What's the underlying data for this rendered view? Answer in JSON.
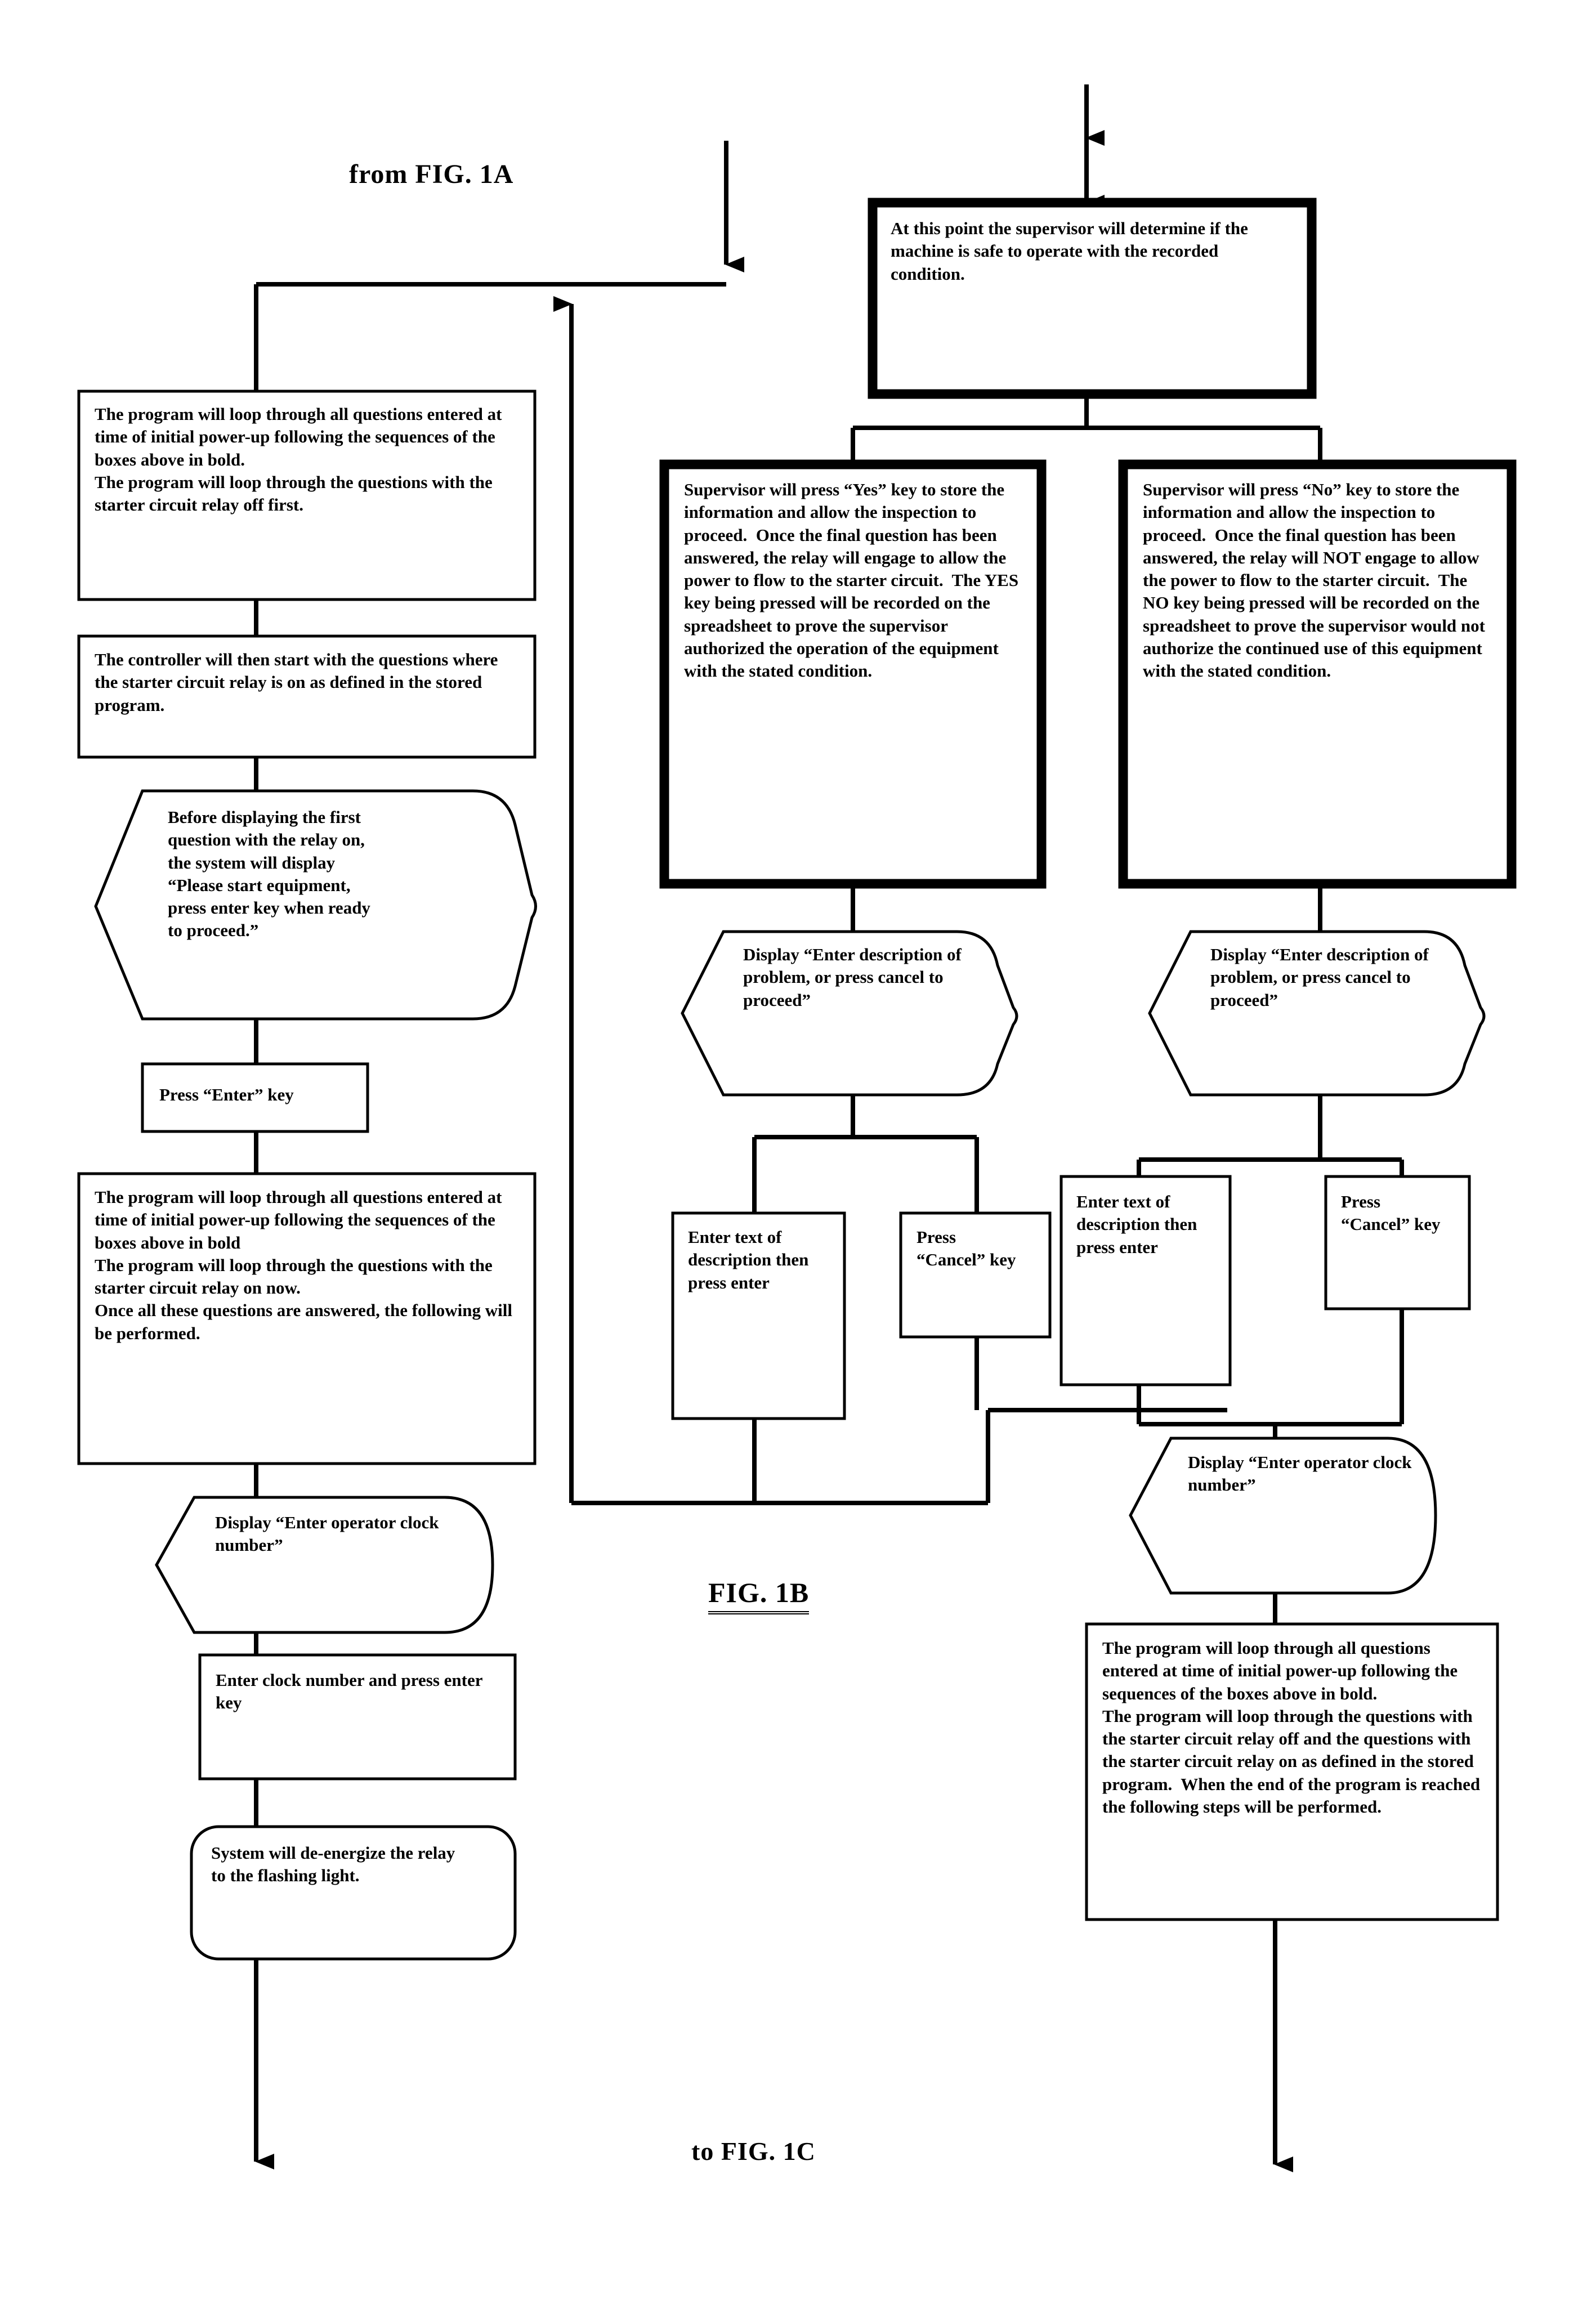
{
  "figure": {
    "from_label": "from FIG.  1A",
    "figure_label": "FIG.  1B",
    "to_label": "to FIG.  1C"
  },
  "nodes": {
    "left_loop_1": "The program will loop through all questions entered at time of initial power-up following the sequences of the boxes above in bold.\nThe program will loop through the questions with the starter circuit relay off first.",
    "controller_start": "The controller will then start with the questions where the starter circuit relay is on as defined in the stored program.",
    "before_display": "Before displaying the first question with the relay on, the system will display “Please start equipment, press enter key when ready to proceed.”",
    "press_enter": "Press “Enter” key",
    "left_loop_2": "The program will loop through all questions entered at time of initial power-up following the sequences of the boxes above in bold\nThe program will loop through the questions with the starter circuit relay on now.\nOnce all these questions are answered, the following will be performed.",
    "display_clock_left": "Display “Enter operator clock number”",
    "enter_clock_left": "Enter clock number and press enter key",
    "deenergize": "System will de-energize the relay to the flashing light.",
    "supervisor_determine": "At this point the supervisor will determine if the machine is safe to operate with the recorded condition.",
    "supervisor_yes": "Supervisor will press “Yes” key to store the information and allow the inspection to proceed.  Once the final question has been answered, the relay will engage to allow the power to flow to the starter circuit.  The YES key being pressed will be recorded on the spreadsheet to prove the supervisor authorized the operation of the equipment with the stated condition.",
    "supervisor_no": "Supervisor will press “No” key to store the information and allow the inspection to proceed.  Once the final question has been answered, the relay will NOT engage to allow the power to flow to the starter circuit.  The NO key being pressed will be recorded on the spreadsheet to prove the supervisor would not authorize the continued use of this equipment with the stated condition.",
    "display_desc_yes": "Display “Enter description of problem, or press cancel to proceed”",
    "display_desc_no": "Display “Enter description of problem, or press cancel to proceed”",
    "enter_text_yes": "Enter text of description then press enter",
    "press_cancel_yes": "Press “Cancel” key",
    "enter_text_no": "Enter text of description then press enter",
    "press_cancel_no": "Press “Cancel” key",
    "display_clock_right": "Display “Enter operator clock number”",
    "right_loop": "The program will loop through all questions entered at time of initial power-up following the sequences of the boxes above in bold.\nThe program will loop through the questions with the starter circuit relay off and the questions with the starter circuit relay on as defined in the stored program.  When the end of the program is reached the following steps will be performed."
  },
  "colors": {
    "line": "#000000",
    "fill": "#ffffff"
  }
}
